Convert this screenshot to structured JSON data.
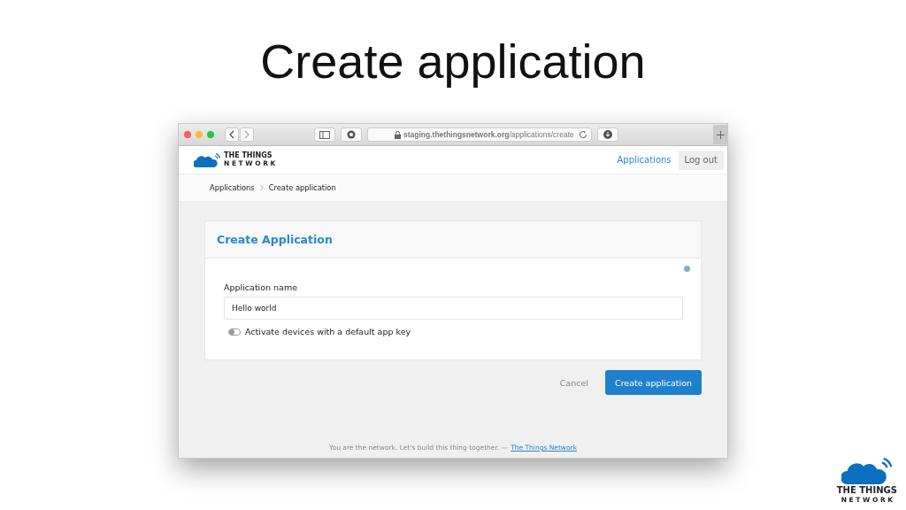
{
  "slide_title": "Create application",
  "browser": {
    "url": "**staging.thethingsnetwork.org**/applications/create"
  },
  "nav": {
    "logo_line1": "THE THINGS",
    "logo_line2": "N E T W O R K",
    "links": [
      {
        "label": "Applications",
        "kind": "link"
      },
      {
        "label": "Log out",
        "kind": "button"
      }
    ]
  },
  "breadcrumb": [
    "Applications",
    "Create application"
  ],
  "card": {
    "title": "Create Application",
    "field_label": "Application name",
    "field_value": "Hello world",
    "toggle": {
      "label": "Activate devices with a default app key",
      "checked": false
    }
  },
  "actions": {
    "cancel": "Cancel",
    "submit": "Create application"
  },
  "footer": {
    "text": "You are the network. Let's build this thing together. —",
    "link": "The Things Network"
  },
  "corner_logo": {
    "line1": "THE THINGS",
    "line2": "N E T W O R K"
  }
}
